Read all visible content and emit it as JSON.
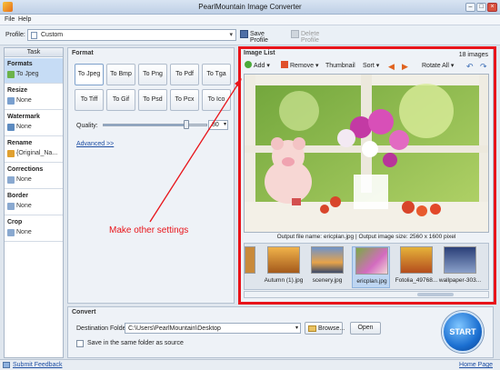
{
  "window": {
    "title": "PearlMountain Image Converter"
  },
  "menu": {
    "file": "File",
    "help": "Help"
  },
  "profile": {
    "label": "Profile:",
    "value": "Custom",
    "save": "Save Profile",
    "delete": "Delete Profile"
  },
  "tasks": {
    "head": "Task",
    "items": [
      {
        "name": "Formats",
        "value": "To Jpeg"
      },
      {
        "name": "Resize",
        "value": "None"
      },
      {
        "name": "Watermark",
        "value": "None"
      },
      {
        "name": "Rename",
        "value": "{Original_Na..."
      },
      {
        "name": "Corrections",
        "value": "None"
      },
      {
        "name": "Border",
        "value": "None"
      },
      {
        "name": "Crop",
        "value": "None"
      }
    ]
  },
  "format": {
    "head": "Format",
    "buttons": [
      "To Jpeg",
      "To Bmp",
      "To Png",
      "To Pdf",
      "To Tga",
      "To Tiff",
      "To Gif",
      "To Psd",
      "To Pcx",
      "To Ico"
    ],
    "quality_label": "Quality:",
    "quality_value": "80",
    "quality_level": 0.8,
    "advanced": "Advanced >>"
  },
  "imagelist": {
    "head": "Image List",
    "count": "18 images",
    "toolbar": {
      "add": "Add",
      "remove": "Remove",
      "thumbnail": "Thumbnail",
      "sort": "Sort",
      "rotate": "Rotate All"
    },
    "output_info": "Output file name: ericplan.jpg | Output image size: 2560 x 1600 pixel",
    "thumbs": [
      "Autumn (1).jpg",
      "scenery.jpg",
      "ericplan.jpg",
      "Fotolia_49768...",
      "wallpaper-303..."
    ]
  },
  "annotation": {
    "text": "Make other settings"
  },
  "convert": {
    "head": "Convert",
    "dest_label": "Destination Folder:",
    "dest_value": "C:\\Users\\PearlMountain\\Desktop",
    "browse": "Browse...",
    "open": "Open",
    "same_folder": "Save in the same folder as source",
    "start": "START"
  },
  "status": {
    "feedback": "Submit Feedback",
    "homepage": "Home Page"
  },
  "colors": {
    "accent": "#1b6fd1",
    "annotation": "#e8141a",
    "selected": "#c6dcf5"
  }
}
